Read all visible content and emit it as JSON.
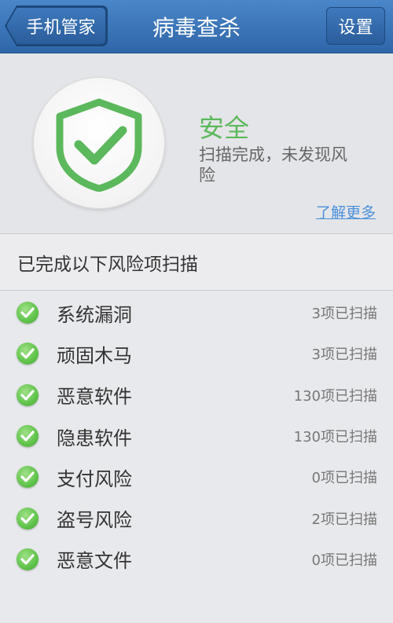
{
  "header": {
    "back_label": "手机管家",
    "title": "病毒查杀",
    "settings_label": "设置"
  },
  "status": {
    "title": "安全",
    "description": "扫描完成，未发现风险",
    "learn_more": "了解更多",
    "color": "#5cb85c"
  },
  "section": {
    "heading": "已完成以下风险项扫描"
  },
  "items": [
    {
      "label": "系统漏洞",
      "count": "3项已扫描"
    },
    {
      "label": "顽固木马",
      "count": "3项已扫描"
    },
    {
      "label": "恶意软件",
      "count": "130项已扫描"
    },
    {
      "label": "隐患软件",
      "count": "130项已扫描"
    },
    {
      "label": "支付风险",
      "count": "0项已扫描"
    },
    {
      "label": "盗号风险",
      "count": "2项已扫描"
    },
    {
      "label": "恶意文件",
      "count": "0项已扫描"
    }
  ]
}
